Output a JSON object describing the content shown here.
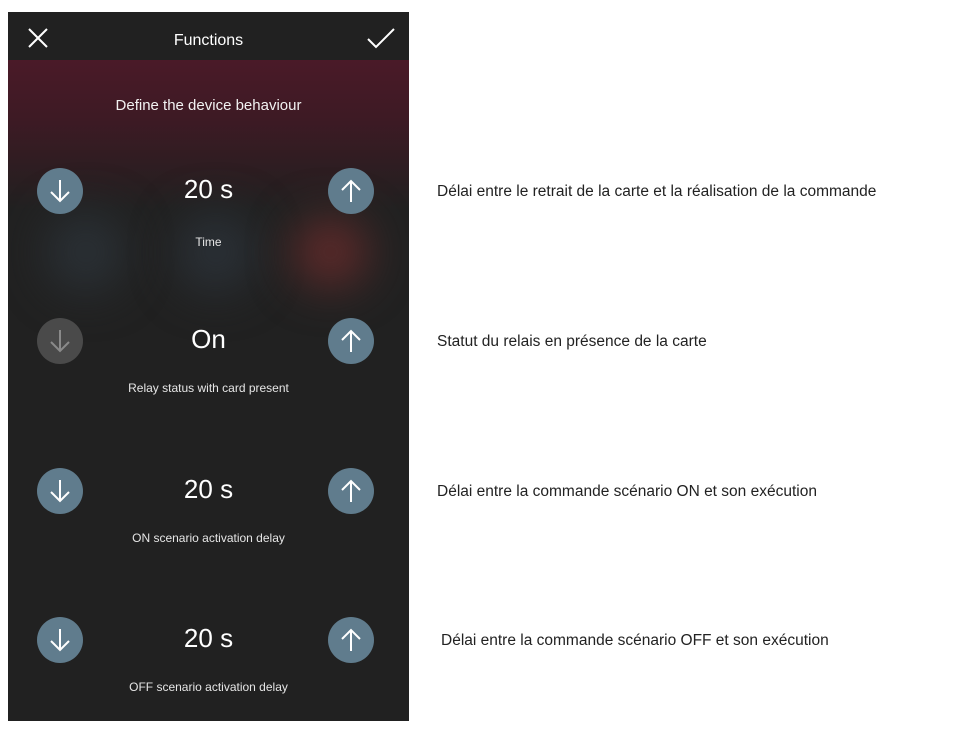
{
  "header": {
    "title": "Functions",
    "close_icon": "close-icon",
    "confirm_icon": "checkmark-icon"
  },
  "subtitle": "Define the device behaviour",
  "settings": [
    {
      "value": "20 s",
      "label": "Time",
      "decrease_enabled": true,
      "increase_enabled": true
    },
    {
      "value": "On",
      "label": "Relay status with card present",
      "decrease_enabled": false,
      "increase_enabled": true
    },
    {
      "value": "20 s",
      "label": "ON scenario activation delay",
      "decrease_enabled": true,
      "increase_enabled": true
    },
    {
      "value": "20 s",
      "label": "OFF scenario activation delay",
      "decrease_enabled": true,
      "increase_enabled": true
    }
  ],
  "annotations": [
    "Délai entre le retrait de la carte et la réalisation de la commande",
    "Statut du relais en présence de la carte",
    "Délai entre la commande scénario ON et son exécution",
    "Délai entre la commande scénario OFF et son exécution"
  ],
  "colors": {
    "background": "#212121",
    "button": "#607c8d",
    "button_disabled": "#4a4a4a",
    "accent_glow": "#4a1a28"
  }
}
